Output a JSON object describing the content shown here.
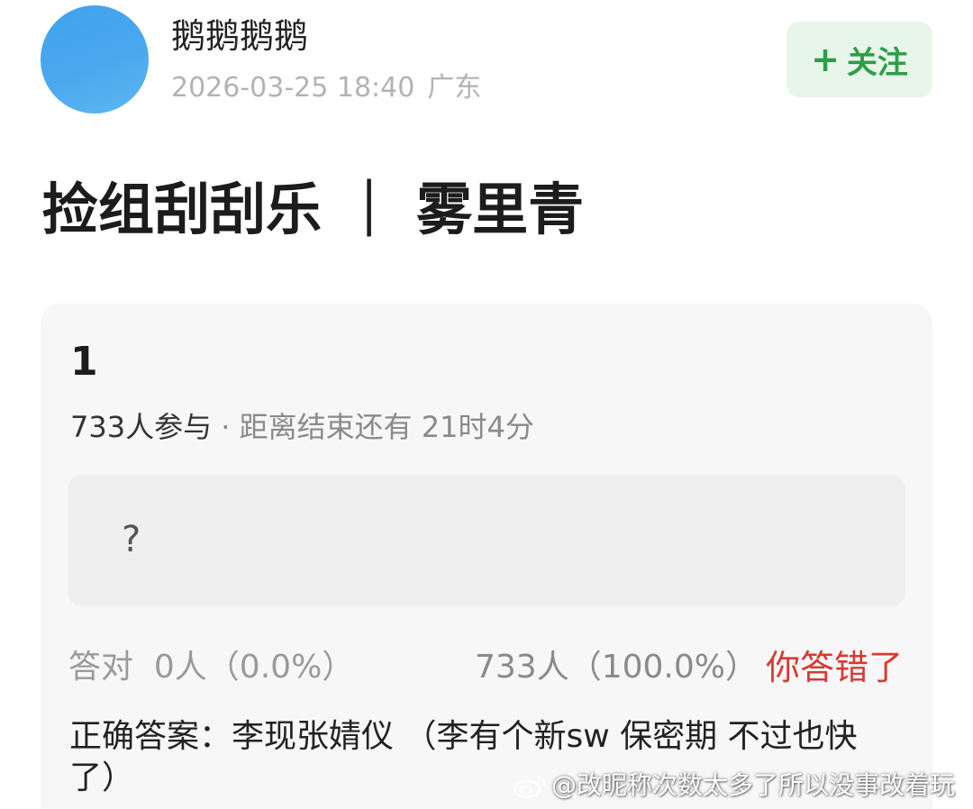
{
  "author": {
    "name": "鹅鹅鹅鹅",
    "timestamp": "2026-03-25 18:40",
    "location": "广东",
    "avatar_color": "#45a6ee"
  },
  "follow_button": {
    "icon": "plus-icon",
    "plus": "+",
    "label": "关注",
    "color": "#2e9e48"
  },
  "post": {
    "title": "捡组刮刮乐 ｜ 雾里青"
  },
  "quiz": {
    "title": "1",
    "participants": "733人参与",
    "separator": " · ",
    "remaining": "距离结束还有 21时4分",
    "option_text": "?",
    "correct_label": "答对",
    "correct_count": "0人（0.0%）",
    "other_count": "733人（100.0%）",
    "wrong_label": "你答错了",
    "wrong_color": "#d63b32",
    "answer": "正确答案：李现张婧仪 （李有个新sw 保密期 不过也快了）"
  },
  "watermark": {
    "icon": "weibo-icon",
    "text": "@改昵称次数太多了所以没事改着玩"
  }
}
